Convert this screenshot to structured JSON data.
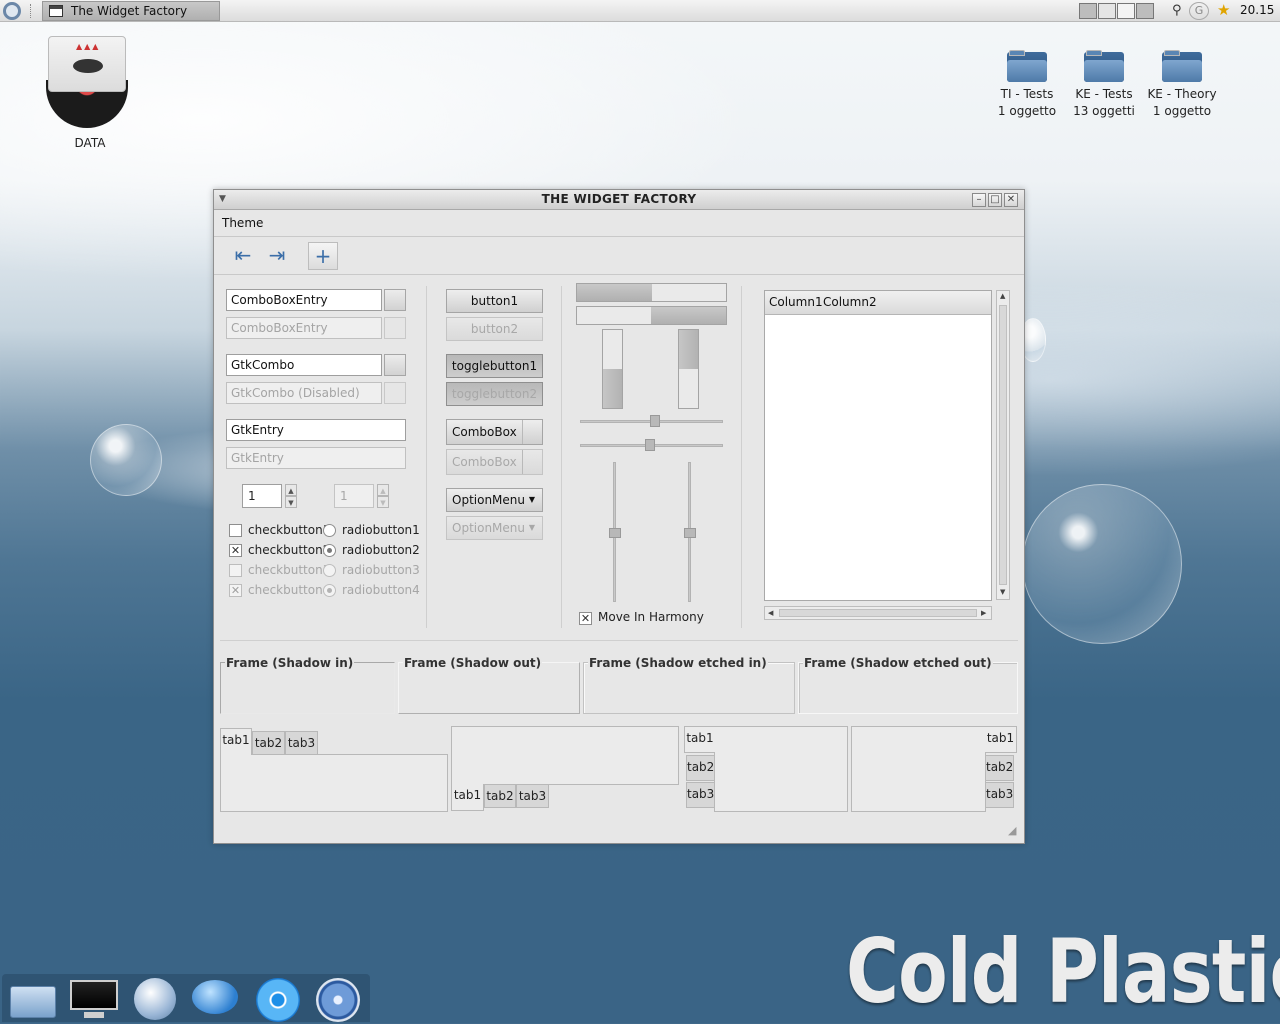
{
  "top_panel": {
    "window_button_label": "The Widget Factory",
    "clock": "20.15",
    "tray_icon_b": "G"
  },
  "desktop": {
    "disc_label": "DATA",
    "folders": [
      {
        "name": "TI - Tests",
        "count": "1 oggetto"
      },
      {
        "name": "KE - Tests",
        "count": "13 oggetti"
      },
      {
        "name": "KE - Theory",
        "count": "1 oggetto"
      }
    ],
    "brand_text": "Cold Plastic"
  },
  "window": {
    "title": "THE WIDGET FACTORY",
    "menu": {
      "theme": "Theme"
    },
    "toolbar": {
      "back_icon": "⇤",
      "forward_icon": "⇥",
      "add_icon": "+"
    },
    "left": {
      "comboentry_1": "ComboBoxEntry",
      "comboentry_2_disabled": "ComboBoxEntry",
      "gtkcombo_1": "GtkCombo",
      "gtkcombo_2_disabled": "GtkCombo (Disabled)",
      "entry_1": "GtkEntry",
      "entry_2_disabled": "GtkEntry",
      "spin_1": "1",
      "spin_2_disabled": "1",
      "checks": [
        {
          "label": "checkbutton1",
          "checked": false,
          "disabled": false
        },
        {
          "label": "checkbutton2",
          "checked": true,
          "disabled": false
        },
        {
          "label": "checkbutton3",
          "checked": false,
          "disabled": true
        },
        {
          "label": "checkbutton4",
          "checked": true,
          "disabled": true
        }
      ],
      "radios": [
        {
          "label": "radiobutton1",
          "selected": false,
          "disabled": false
        },
        {
          "label": "radiobutton2",
          "selected": true,
          "disabled": false
        },
        {
          "label": "radiobutton3",
          "selected": false,
          "disabled": true
        },
        {
          "label": "radiobutton4",
          "selected": true,
          "disabled": true
        }
      ]
    },
    "buttons": {
      "button1": "button1",
      "button2": "button2",
      "toggle1": "togglebutton1",
      "toggle2": "togglebutton2",
      "combobox_1": "ComboBox",
      "combobox_2": "ComboBox",
      "optionmenu_1": "OptionMenu",
      "optionmenu_2": "OptionMenu"
    },
    "ranges": {
      "hprogress_1_fraction": 0.5,
      "hprogress_2_fraction": 0.5,
      "vprogress_1_fraction": 0.5,
      "vprogress_2_fraction": 0.5,
      "hscale_1_fraction": 0.52,
      "hscale_2_fraction": 0.48,
      "vscale_1_fraction": 0.5,
      "vscale_2_fraction": 0.5,
      "harmony_checked": true,
      "harmony_label": "Move In Harmony"
    },
    "tree": {
      "columns": [
        "Column1",
        "Column2"
      ]
    },
    "frames": [
      {
        "label": "Frame (Shadow in)",
        "style": "in"
      },
      {
        "label": "Frame (Shadow out)",
        "style": "out"
      },
      {
        "label": "Frame (Shadow etched in)",
        "style": "etched-in"
      },
      {
        "label": "Frame (Shadow etched out)",
        "style": "etched-out"
      }
    ],
    "tabs": [
      "tab1",
      "tab2",
      "tab3"
    ]
  },
  "colors": {
    "accent_blue": "#3b6ea8",
    "window_bg": "#e7e7e7",
    "desktop_deep_blue": "#3a6486"
  }
}
